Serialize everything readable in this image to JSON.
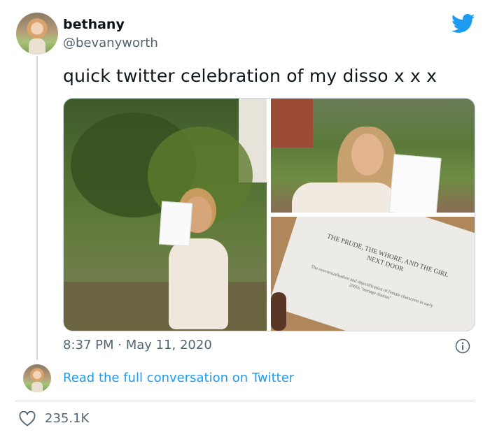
{
  "tweet": {
    "display_name": "bethany",
    "handle": "@bevanyworth",
    "text": "quick twitter celebration of my disso x x x",
    "timestamp": "8:37 PM · May 11, 2020",
    "read_link": "Read the full conversation on Twitter",
    "like_count": "235.1K",
    "document_title": "The Prude, The Whore, and the Girl Next Door",
    "document_subtitle": "The oversexualisation and objectification of female characters in early 2000s \"teenage dramas\""
  },
  "icons": {
    "brand": "twitter-bird-icon",
    "info": "info-icon",
    "like": "heart-icon"
  },
  "colors": {
    "brand_blue": "#1d9bf0",
    "secondary_text": "#536471",
    "divider": "#cfd9de"
  }
}
